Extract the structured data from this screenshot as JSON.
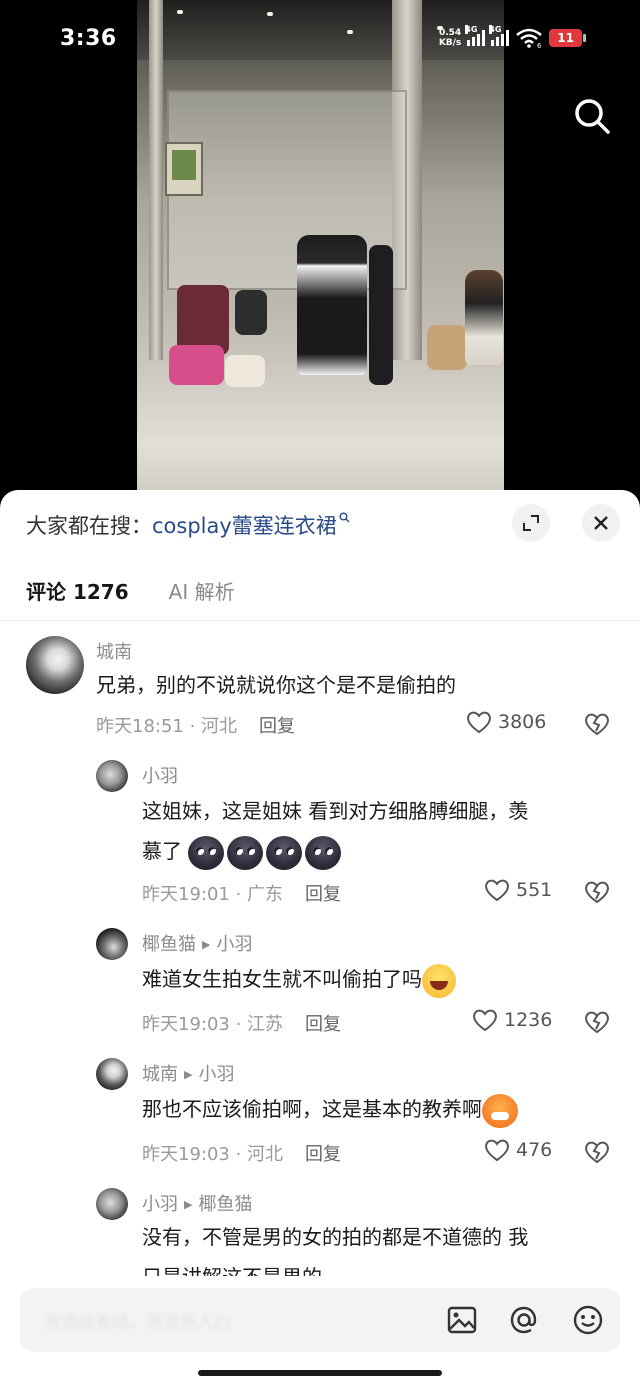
{
  "status_bar": {
    "time": "3:36",
    "net_speed_top": "0.54",
    "net_speed_bottom": "KB/s",
    "sim1": "4G",
    "sim2": "4G",
    "wifi_badge": "6",
    "battery": "11"
  },
  "hot_search": {
    "prefix": "大家都在搜：",
    "term": "cosplay蕾塞连衣裙"
  },
  "tabs": [
    {
      "label": "评论 1276"
    },
    {
      "label": "AI 解析"
    }
  ],
  "comments": [
    {
      "user": "城南",
      "text": "兄弟，别的不说就说你这个是不是偷拍的",
      "time": "昨天18:51 · 河北",
      "reply_label": "回复",
      "likes": "3806"
    },
    {
      "user": "小羽",
      "text_line1": "这姐妹，这是姐妹 看到对方细胳膊细腿，羡",
      "text_line2": "慕了",
      "time": "昨天19:01 · 广东",
      "reply_label": "回复",
      "likes": "551"
    },
    {
      "user": "椰鱼猫",
      "reply_to": "小羽",
      "text": "难道女生拍女生就不叫偷拍了吗",
      "time": "昨天19:03 · 江苏",
      "reply_label": "回复",
      "likes": "1236"
    },
    {
      "user": "城南",
      "reply_to": "小羽",
      "text": "那也不应该偷拍啊，这是基本的教养啊",
      "time": "昨天19:03 · 河北",
      "reply_label": "回复",
      "likes": "476"
    },
    {
      "user": "小羽",
      "reply_to": "椰鱼猫",
      "text_line1": "没有，不管是男的女的拍的都是不道德的 我",
      "text_line2": "只是讲解这不是男的"
    }
  ],
  "input_bar": {
    "placeholder": "善语结善缘，恶言伤人心"
  },
  "icons": {
    "search": "search-icon",
    "expand": "expand-icon",
    "close": "close-icon",
    "like": "heart-icon",
    "dislike": "broken-heart-icon",
    "image": "image-icon",
    "mention": "at-icon",
    "emoji": "emoji-icon"
  },
  "colors": {
    "hot_term": "#2a4a8a",
    "battery": "#e0383d",
    "meta": "#9a9a9a"
  }
}
